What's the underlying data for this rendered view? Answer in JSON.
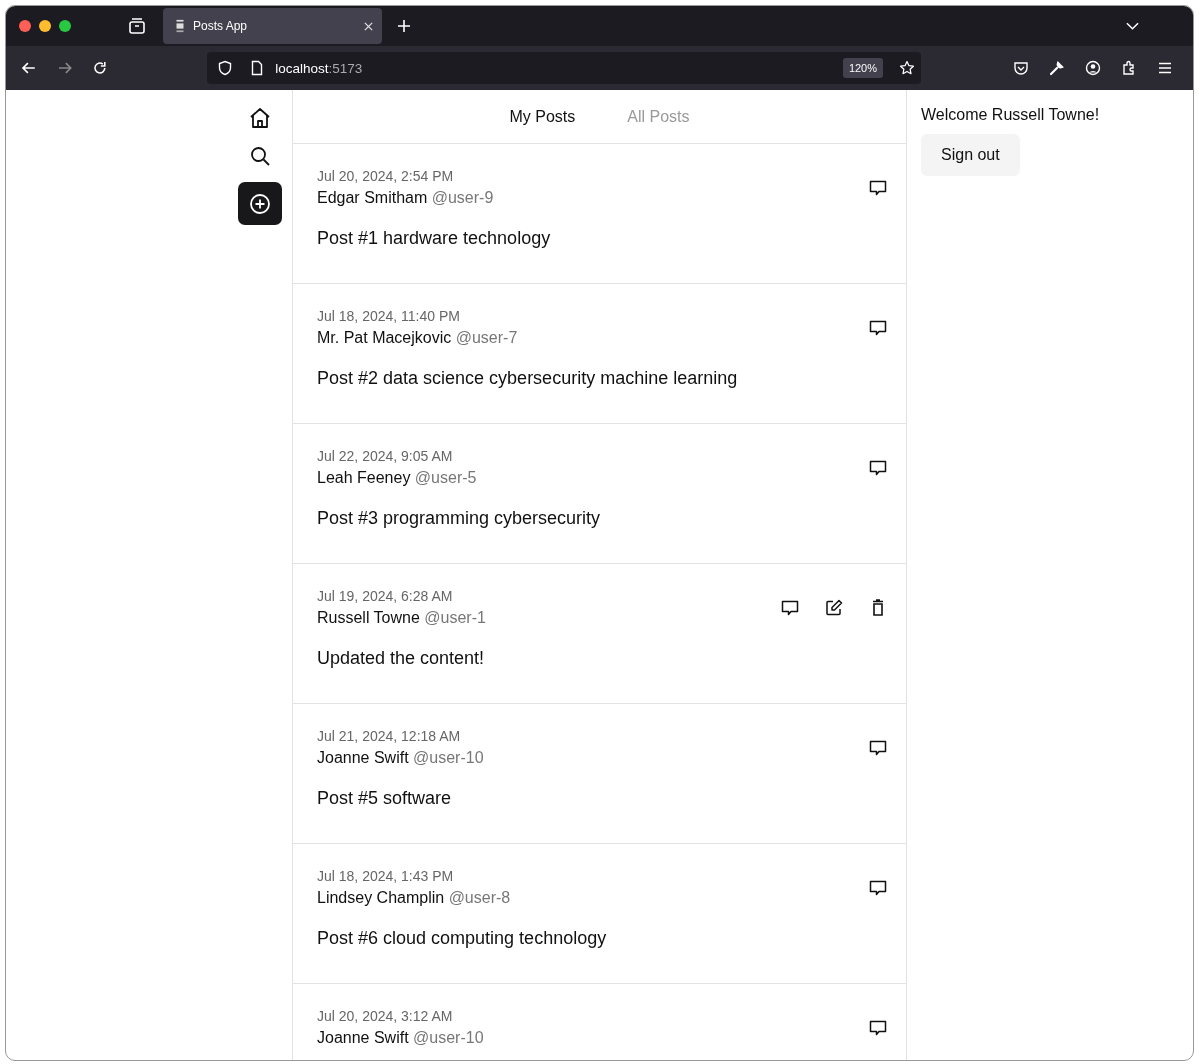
{
  "browser": {
    "tab_title": "Posts App",
    "url_host": "localhost",
    "url_port": ":5173",
    "zoom": "120%"
  },
  "tabs": [
    {
      "label": "My Posts",
      "selected": true
    },
    {
      "label": "All Posts",
      "selected": false
    }
  ],
  "posts": [
    {
      "date": "Jul 20, 2024, 2:54 PM",
      "author": "Edgar Smitham",
      "handle": "@user-9",
      "content": "Post #1 hardware technology",
      "own": false
    },
    {
      "date": "Jul 18, 2024, 11:40 PM",
      "author": "Mr. Pat Macejkovic",
      "handle": "@user-7",
      "content": "Post #2 data science cybersecurity machine learning",
      "own": false
    },
    {
      "date": "Jul 22, 2024, 9:05 AM",
      "author": "Leah Feeney",
      "handle": "@user-5",
      "content": "Post #3 programming cybersecurity",
      "own": false
    },
    {
      "date": "Jul 19, 2024, 6:28 AM",
      "author": "Russell Towne",
      "handle": "@user-1",
      "content": "Updated the content!",
      "own": true
    },
    {
      "date": "Jul 21, 2024, 12:18 AM",
      "author": "Joanne Swift",
      "handle": "@user-10",
      "content": "Post #5 software",
      "own": false
    },
    {
      "date": "Jul 18, 2024, 1:43 PM",
      "author": "Lindsey Champlin",
      "handle": "@user-8",
      "content": "Post #6 cloud computing technology",
      "own": false
    },
    {
      "date": "Jul 20, 2024, 3:12 AM",
      "author": "Joanne Swift",
      "handle": "@user-10",
      "own": false
    }
  ],
  "welcome": "Welcome Russell Towne!",
  "sign_out": "Sign out"
}
